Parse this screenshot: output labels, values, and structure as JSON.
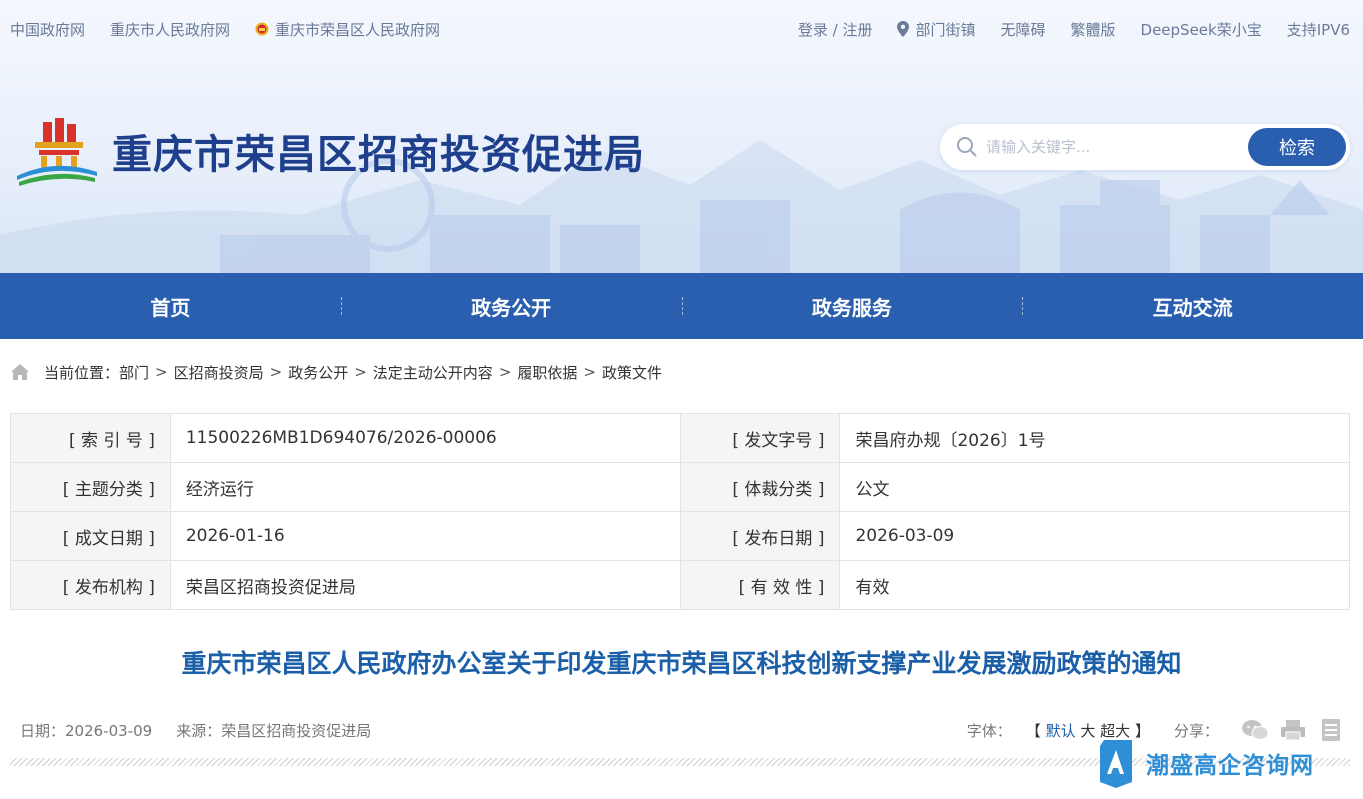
{
  "top_left_links": [
    "中国政府网",
    "重庆市人民政府网",
    "重庆市荣昌区人民政府网"
  ],
  "top_right_links": [
    "登录 / 注册",
    "部门街镇",
    "无障碍",
    "繁體版",
    "DeepSeek荣小宝",
    "支持IPV6"
  ],
  "site_title": "重庆市荣昌区招商投资促进局",
  "search": {
    "placeholder": "请输入关键字...",
    "button": "检索"
  },
  "nav": [
    "首页",
    "政务公开",
    "政务服务",
    "互动交流"
  ],
  "breadcrumb": {
    "label": "当前位置：",
    "items": [
      "部门",
      "区招商投资局",
      "政务公开",
      "法定主动公开内容",
      "履职依据",
      "政策文件"
    ],
    "separator": ">"
  },
  "info_table": [
    {
      "label": "[ 索 引 号 ]",
      "value": "11500226MB1D694076/2026-00006",
      "label2": "[ 发文字号 ]",
      "value2": "荣昌府办规〔2026〕1号"
    },
    {
      "label": "[ 主题分类 ]",
      "value": "经济运行",
      "label2": "[ 体裁分类 ]",
      "value2": "公文"
    },
    {
      "label": "[ 成文日期 ]",
      "value": "2026-01-16",
      "label2": "[ 发布日期 ]",
      "value2": "2026-03-09"
    },
    {
      "label": "[ 发布机构 ]",
      "value": "荣昌区招商投资促进局",
      "label2": "[ 有 效 性 ]",
      "value2": "有效"
    }
  ],
  "article": {
    "title": "重庆市荣昌区人民政府办公室关于印发重庆市荣昌区科技创新支撑产业发展激励政策的通知",
    "date": "日期：2026-03-09",
    "source": "来源：荣昌区招商投资促进局",
    "font_label": "字体：",
    "font_open": "【",
    "font_options": [
      "默认",
      "大",
      "超大"
    ],
    "font_close": "】",
    "share_label": "分享："
  },
  "watermark": "潮盛高企咨询网",
  "colors": {
    "nav": "#2a5fb0",
    "title": "#1e3f8c",
    "article_title": "#1b5fa8"
  },
  "icons": [
    "emblem-icon",
    "location-pin-icon",
    "search-icon",
    "home-icon",
    "wechat-icon",
    "print-icon",
    "document-icon"
  ]
}
